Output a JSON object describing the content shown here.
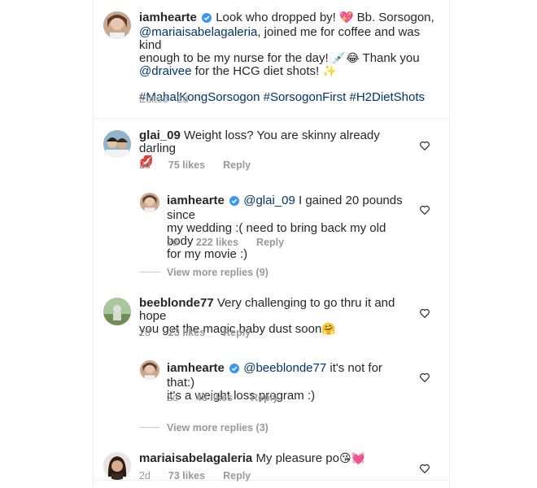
{
  "caption": {
    "username": "iamhearte",
    "lines": [
      "Look who dropped by! 💖 Bb. Sorsogon,",
      "@mariaisabelagaleria, joined me for coffee and was kind",
      "enough to be my nurse for the day! 💉😂 Thank you",
      "@draivee for the HCG diet shots! ✨"
    ],
    "text_1": "Look who dropped by!",
    "emoji_1": "💖",
    "text_2": "Bb. Sorsogon,",
    "mention_1": "@mariaisabelagaleria",
    "text_3": ", joined me for coffee and was kind",
    "text_4": "enough to be my nurse for the day!",
    "emoji_2": "💉😂",
    "text_5": "Thank you",
    "mention_2": "@draivee",
    "text_6": "for the HCG diet shots!",
    "emoji_3": "✨",
    "hashtags": "#MahalKongSorsogon #SorsogonFirst #H2DietShots",
    "meta": "Edited · 2d"
  },
  "comments": [
    {
      "username": "glai_09",
      "text_a": "Weight loss? You are skinny already darling",
      "emoji": "💋",
      "time": "2d",
      "likes": "75 likes",
      "reply": "Reply"
    },
    {
      "username": "iamhearte",
      "mention": "@glai_09",
      "text_a": "I gained 20 pounds since",
      "text_b": "my wedding :( need to bring back my old body",
      "text_c": "for my movie :)",
      "time": "2d",
      "likes": "222 likes",
      "reply": "Reply"
    },
    {
      "view_more": "View more replies (9)"
    },
    {
      "username": "beeblonde77",
      "text_a": "Very challenging to go thru it and hope",
      "text_b": "you get the magic baby dust soon",
      "emoji": "🤗",
      "time": "2d",
      "likes": "23 likes",
      "reply": "Reply"
    },
    {
      "username": "iamhearte",
      "mention": "@beeblonde77",
      "text_a": "it's not for that:)",
      "text_b": "it's a weight loss program :)",
      "time": "2d",
      "likes": "48 likes",
      "reply": "Reply"
    },
    {
      "view_more": "View more replies (3)"
    },
    {
      "username": "mariaisabelagaleria",
      "text_a": "My pleasure po",
      "emoji": "😘💓",
      "time": "2d",
      "likes": "73 likes",
      "reply": "Reply"
    }
  ],
  "colors": {
    "link": "#003569",
    "verified": "#3897f0",
    "muted": "#999999"
  },
  "icons": {
    "verified": "verified-badge-icon",
    "like": "heart-outline-icon"
  }
}
